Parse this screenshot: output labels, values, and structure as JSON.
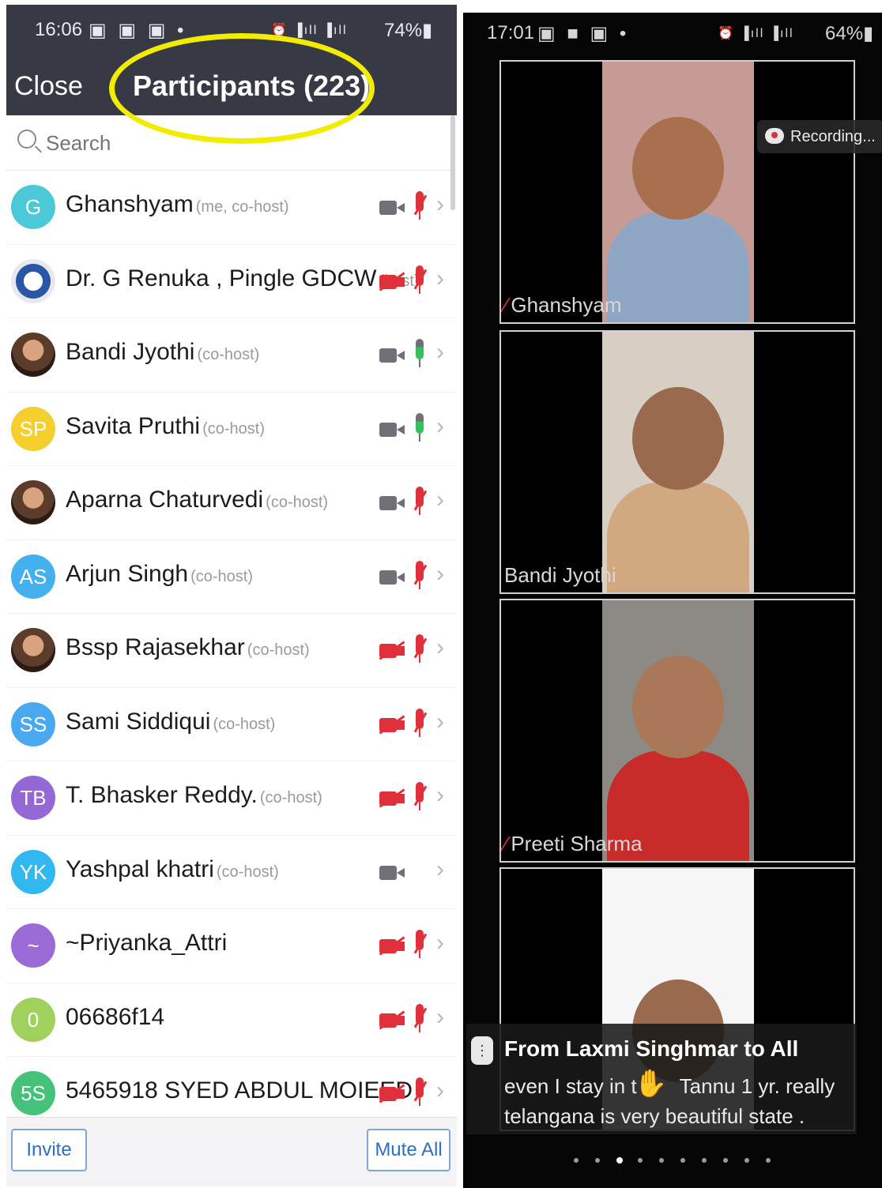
{
  "left": {
    "status": {
      "time": "16:06",
      "icons": "▣ ▣ ▣ •",
      "signal": "⏰ ▐ıll ▐ıll",
      "battery": "74%▮"
    },
    "header": {
      "close_label": "Close",
      "title": "Participants (223)"
    },
    "search": {
      "placeholder": "Search"
    },
    "participants": [
      {
        "name": "Ghanshyam",
        "role": "(me, co-host)",
        "initials": "G",
        "avatar_color": "#4cc9d8",
        "avatar_type": "initials",
        "video": "on",
        "audio": "muted"
      },
      {
        "name": "Dr. G Renuka , Pingle GDCW",
        "role": "(host)",
        "initials": "",
        "avatar_color": "#2a56a5",
        "avatar_type": "logo",
        "video": "off",
        "audio": "muted"
      },
      {
        "name": "Bandi Jyothi",
        "role": "(co-host)",
        "initials": "",
        "avatar_color": "#8b4a33",
        "avatar_type": "photo",
        "video": "on",
        "audio": "on"
      },
      {
        "name": "Savita Pruthi",
        "role": "(co-host)",
        "initials": "SP",
        "avatar_color": "#f5cf2d",
        "avatar_type": "initials",
        "video": "on",
        "audio": "on"
      },
      {
        "name": "Aparna Chaturvedi",
        "role": "(co-host)",
        "initials": "",
        "avatar_color": "#5a3b2c",
        "avatar_type": "photo",
        "video": "on",
        "audio": "muted"
      },
      {
        "name": "Arjun Singh",
        "role": "(co-host)",
        "initials": "AS",
        "avatar_color": "#44b0ee",
        "avatar_type": "initials",
        "video": "on",
        "audio": "muted"
      },
      {
        "name": "Bssp Rajasekhar",
        "role": "(co-host)",
        "initials": "",
        "avatar_color": "#7a5c3c",
        "avatar_type": "photo",
        "video": "off",
        "audio": "muted"
      },
      {
        "name": "Sami Siddiqui",
        "role": "(co-host)",
        "initials": "SS",
        "avatar_color": "#4aa8ef",
        "avatar_type": "initials",
        "video": "off",
        "audio": "muted"
      },
      {
        "name": "T. Bhasker Reddy.",
        "role": "(co-host)",
        "initials": "TB",
        "avatar_color": "#9469d6",
        "avatar_type": "initials",
        "video": "off",
        "audio": "muted"
      },
      {
        "name": "Yashpal khatri",
        "role": "(co-host)",
        "initials": "YK",
        "avatar_color": "#31b8ef",
        "avatar_type": "initials",
        "video": "on",
        "audio": "none"
      },
      {
        "name": "~Priyanka_Attri",
        "role": "",
        "initials": "~",
        "avatar_color": "#9a6ad6",
        "avatar_type": "initials",
        "video": "off",
        "audio": "muted"
      },
      {
        "name": "06686f14",
        "role": "",
        "initials": "0",
        "avatar_color": "#9fd15c",
        "avatar_type": "initials",
        "video": "off",
        "audio": "muted"
      },
      {
        "name": "5465918 SYED ABDUL MOIEED",
        "role": "",
        "initials": "5S",
        "avatar_color": "#45c27a",
        "avatar_type": "initials",
        "video": "off",
        "audio": "muted"
      }
    ],
    "footer": {
      "invite_label": "Invite",
      "mute_all_label": "Mute All"
    },
    "highlight_color": "#f2ec00"
  },
  "right": {
    "status": {
      "time": "17:01",
      "icons": "▣ ■ ▣ •",
      "signal": "⏰ ▐ıll ▐ıll",
      "battery": "64%▮"
    },
    "recording_label": "Recording...",
    "tiles": [
      {
        "name": "Ghanshyam",
        "muted": true,
        "bg": "#c69a95",
        "skin": "#a8704f",
        "cloth": "#8fa6c5"
      },
      {
        "name": "Bandi Jyothi",
        "muted": false,
        "bg": "#d8cfc4",
        "skin": "#9a6a4e",
        "cloth": "#d2a880"
      },
      {
        "name": "Preeti Sharma",
        "muted": true,
        "bg": "#8d8a86",
        "skin": "#a87858",
        "cloth": "#c92a2a"
      },
      {
        "name": "",
        "muted": false,
        "bg": "#f6f6f6",
        "skin": "#9a6a4e",
        "cloth": "#f0f0f0"
      }
    ],
    "chat": {
      "from": "From Laxmi Singhmar to All",
      "line1": "even I stay in t",
      "line1_tail": "Tannu  1 yr. really",
      "line2": "telangana is very beautiful state ."
    },
    "page_dots": {
      "count": 10,
      "active_index": 2
    }
  }
}
